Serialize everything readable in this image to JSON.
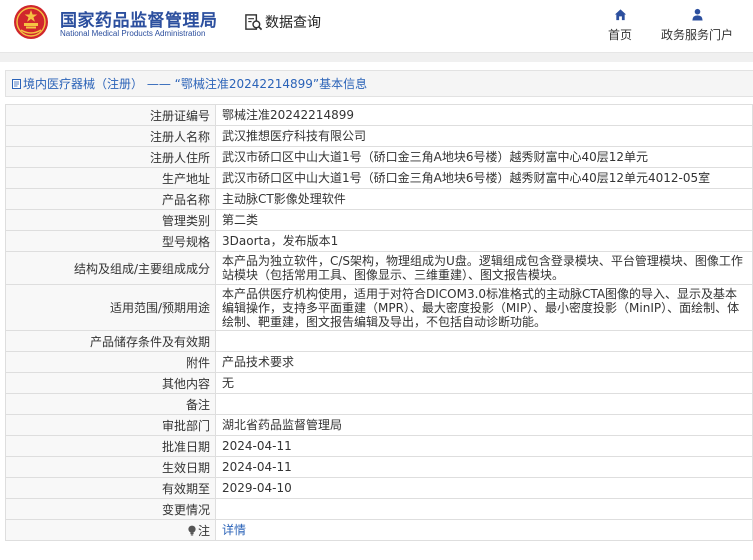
{
  "header": {
    "brand_cn": "国家药品监督管理局",
    "brand_en": "National Medical Products Administration",
    "search_label": "数据查询",
    "nav": [
      {
        "label": "首页",
        "icon": "home-icon"
      },
      {
        "label": "政务服务门户",
        "icon": "user-icon"
      }
    ]
  },
  "title_bar": {
    "category_link": "境内医疗器械（注册）",
    "separator": "——",
    "record_title": "“鄂械注准20242214899”基本信息"
  },
  "rows": [
    {
      "label": "注册证编号",
      "value": "鄂械注准20242214899"
    },
    {
      "label": "注册人名称",
      "value": "武汉推想医疗科技有限公司"
    },
    {
      "label": "注册人住所",
      "value": "武汉市硚口区中山大道1号（硚口金三角A地块6号楼）越秀财富中心40层12单元"
    },
    {
      "label": "生产地址",
      "value": "武汉市硚口区中山大道1号（硚口金三角A地块6号楼）越秀财富中心40层12单元4012-05室"
    },
    {
      "label": "产品名称",
      "value": "主动脉CT影像处理软件"
    },
    {
      "label": "管理类别",
      "value": "第二类"
    },
    {
      "label": "型号规格",
      "value": "3Daorta，发布版本1"
    },
    {
      "label": "结构及组成/主要组成成分",
      "value": "本产品为独立软件，C/S架构，物理组成为U盘。逻辑组成包含登录模块、平台管理模块、图像工作站模块（包括常用工具、图像显示、三维重建）、图文报告模块。"
    },
    {
      "label": "适用范围/预期用途",
      "value": "本产品供医疗机构使用，适用于对符合DICOM3.0标准格式的主动脉CTA图像的导入、显示及基本编辑操作，支持多平面重建（MPR）、最大密度投影（MIP）、最小密度投影（MinIP）、面绘制、体绘制、靶重建，图文报告编辑及导出，不包括自动诊断功能。"
    },
    {
      "label": "产品储存条件及有效期",
      "value": ""
    },
    {
      "label": "附件",
      "value": "产品技术要求"
    },
    {
      "label": "其他内容",
      "value": "无"
    },
    {
      "label": "备注",
      "value": ""
    },
    {
      "label": "审批部门",
      "value": "湖北省药品监督管理局"
    },
    {
      "label": "批准日期",
      "value": "2024-04-11"
    },
    {
      "label": "生效日期",
      "value": "2024-04-11"
    },
    {
      "label": "有效期至",
      "value": "2029-04-10"
    },
    {
      "label": "变更情况",
      "value": ""
    }
  ],
  "note_row": {
    "label": "注",
    "link": "详情",
    "icon": "lightbulb-icon"
  },
  "colors": {
    "brand_blue": "#2c4f9e",
    "link_blue": "#2b63b8",
    "emblem_red": "#d0262d",
    "emblem_gold": "#f5c242"
  }
}
